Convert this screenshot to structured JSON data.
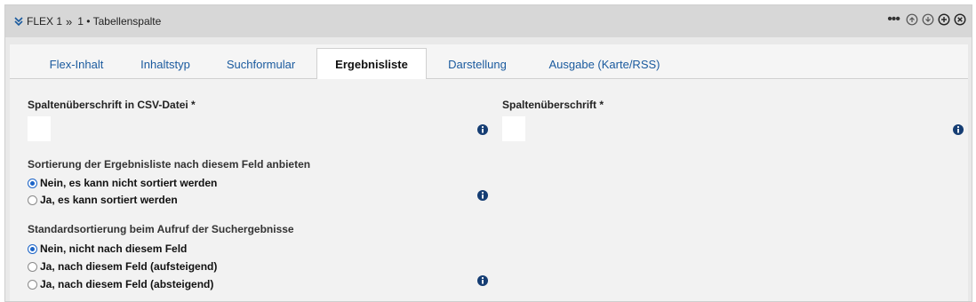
{
  "header": {
    "block_name": "FLEX 1",
    "separator": "»",
    "subtitle": "1 • Tabellenspalte",
    "more_label": "•••"
  },
  "tabs": [
    {
      "label": "Flex-Inhalt",
      "active": false
    },
    {
      "label": "Inhaltstyp",
      "active": false
    },
    {
      "label": "Suchformular",
      "active": false
    },
    {
      "label": "Ergebnisliste",
      "active": true
    },
    {
      "label": "Darstellung",
      "active": false
    },
    {
      "label": "Ausgabe (Karte/RSS)",
      "active": false
    }
  ],
  "form": {
    "csv_heading_label": "Spaltenüberschrift in CSV-Datei *",
    "csv_heading_value": "",
    "column_heading_label": "Spaltenüberschrift *",
    "column_heading_value": "",
    "sort_label": "Sortierung der Ergebnisliste nach diesem Feld anbieten",
    "sort_options": [
      {
        "label": "Nein, es kann nicht sortiert werden",
        "checked": true
      },
      {
        "label": "Ja, es kann sortiert werden",
        "checked": false
      }
    ],
    "default_sort_label": "Standardsortierung beim Aufruf der Suchergebnisse",
    "default_sort_options": [
      {
        "label": "Nein, nicht nach diesem Feld",
        "checked": true
      },
      {
        "label": "Ja, nach diesem Feld (aufsteigend)",
        "checked": false
      },
      {
        "label": "Ja, nach diesem Feld (absteigend)",
        "checked": false
      }
    ]
  },
  "colors": {
    "accent": "#1a63c7",
    "tab_link": "#1a5a9e",
    "info_icon": "#153d73"
  }
}
